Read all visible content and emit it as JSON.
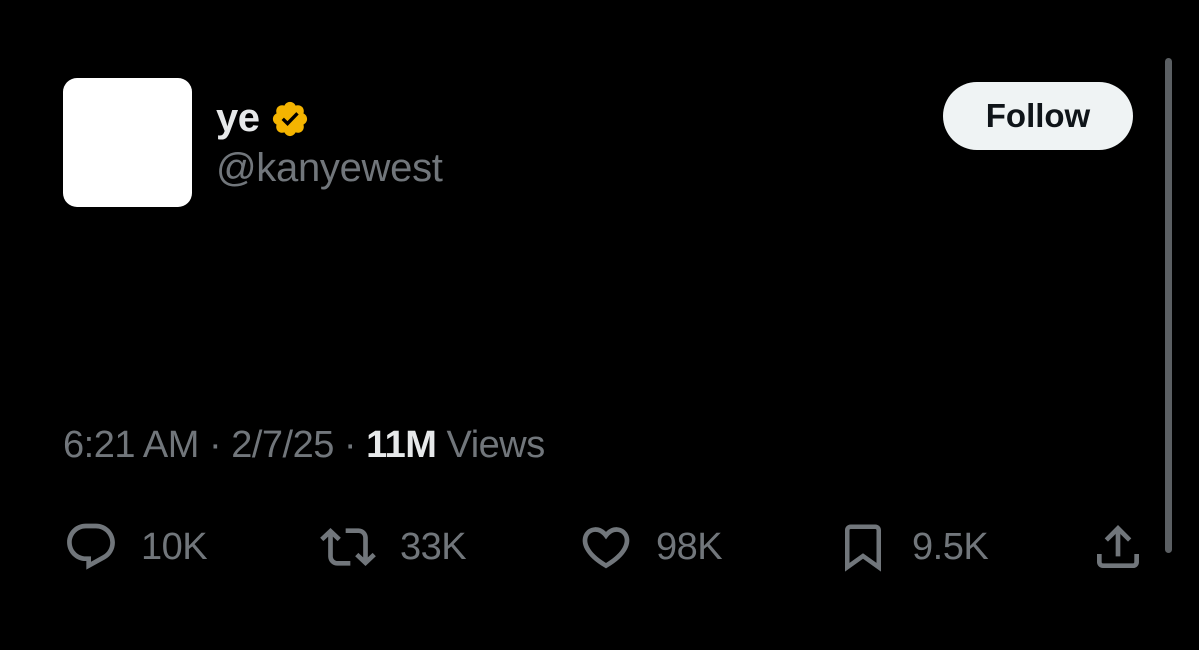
{
  "author": {
    "display_name": "ye",
    "handle": "@kanyewest",
    "verified_badge": "verified-badge-icon",
    "badge_color": "#f4b400"
  },
  "follow_button": {
    "label": "Follow"
  },
  "post": {
    "text": ""
  },
  "meta": {
    "time": "6:21 AM",
    "separator": "·",
    "date": "2/7/25",
    "views_count": "11M",
    "views_label": "Views"
  },
  "actions": {
    "reply": {
      "icon": "reply-icon",
      "count": "10K"
    },
    "repost": {
      "icon": "repost-icon",
      "count": "33K"
    },
    "like": {
      "icon": "heart-icon",
      "count": "98K"
    },
    "bookmark": {
      "icon": "bookmark-icon",
      "count": "9.5K"
    },
    "share": {
      "icon": "share-icon"
    }
  },
  "colors": {
    "background": "#000000",
    "primary_text": "#e7e9ea",
    "secondary_text": "#71767b",
    "follow_bg": "#eff3f4"
  }
}
